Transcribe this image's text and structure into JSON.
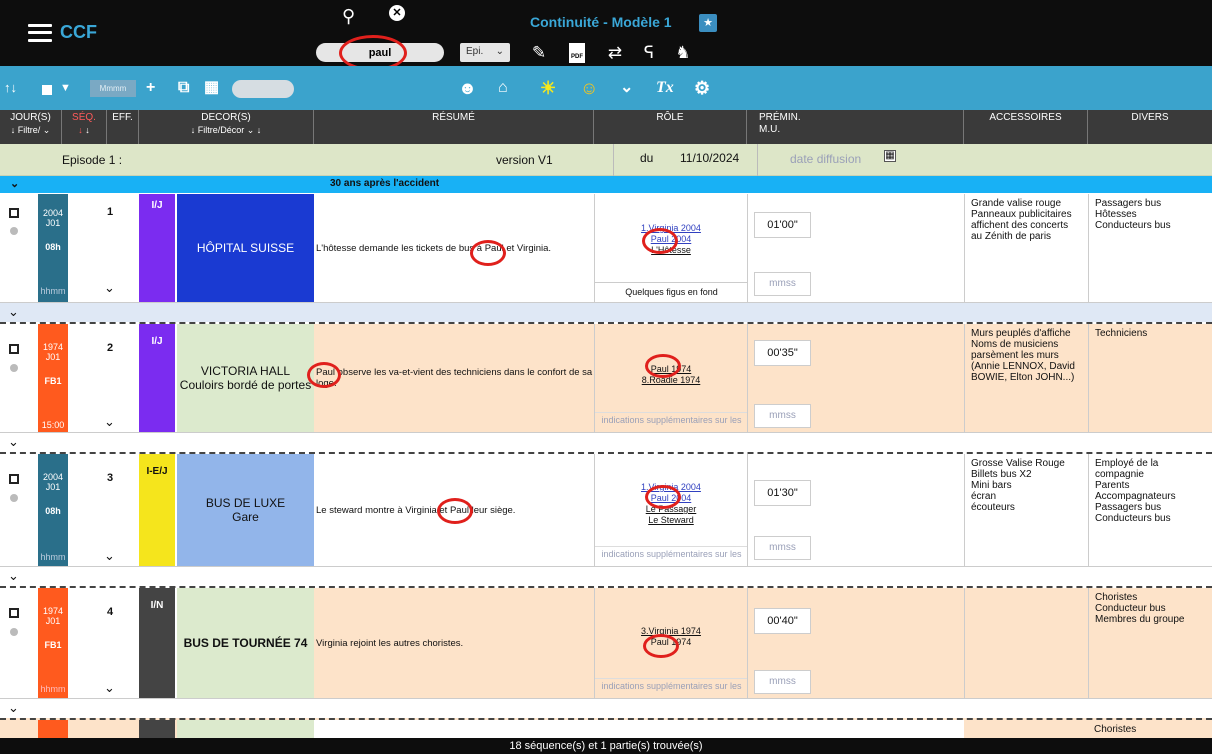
{
  "header": {
    "logo": "CCF",
    "title": "Continuité - Modèle 1",
    "search_value": "paul",
    "episode_select": "Epi.",
    "star": "★"
  },
  "toolbar2": {
    "grey_field": "Mmmm"
  },
  "columns": {
    "jour": "JOUR(S)",
    "jour_filter": "Filtre/",
    "seq": "SÉQ.",
    "eff": "EFF.",
    "decor": "DECOR(S)",
    "decor_filter": "Filtre/Décor",
    "resume": "RÉSUMÉ",
    "role": "RÔLE",
    "premin_1": "PRÉMIN.",
    "premin_2": "M.U.",
    "accessoires": "ACCESSOIRES",
    "divers": "DIVERS"
  },
  "episode": {
    "label": "Episode 1 :",
    "version": "version V1",
    "du": "du",
    "date": "11/10/2024",
    "date_diffusion": "date diffusion"
  },
  "part": {
    "title": "30 ans après l'accident"
  },
  "sequences": [
    {
      "day": "2004 J01",
      "time_code": "08h",
      "hour": "hhmm",
      "num": "1",
      "eff": "I/J",
      "decor_1": "HÔPITAL SUISSE",
      "decor_2": "",
      "resume": "L'hôtesse demande les tickets de bus à Paul et Virginia.",
      "roles": [
        "1.Virginia 2004",
        "Paul 2004",
        "L'Hôtesse"
      ],
      "role_note": "Quelques figus en fond",
      "premin": "01'00\"",
      "premin_ph": "mmss",
      "accessoires": [
        "Grande valise rouge",
        "Panneaux publicitaires",
        "affichent des concerts",
        "au Zénith de paris"
      ],
      "divers": [
        "Passagers bus",
        "Hôtesses",
        "Conducteurs bus"
      ],
      "colors": {
        "day": "#2a6f8a",
        "eff": "#7b2cf0",
        "decor": "#1a3ad2",
        "decor_text": "#ffffff",
        "resume": "#ffffff"
      }
    },
    {
      "day": "1974 J01",
      "time_code": "FB1",
      "hour": "15:00",
      "num": "2",
      "eff": "I/J",
      "decor_1": "VICTORIA HALL",
      "decor_2": "Couloirs bordé de portes",
      "resume": "Paul observe les va-et-vient des techniciens dans le confort de sa loge.",
      "roles": [
        "Paul 1974",
        "8.Roadie 1974"
      ],
      "role_note": "indications supplémentaires sur les",
      "premin": "00'35\"",
      "premin_ph": "mmss",
      "accessoires": [
        "Murs peuplés d'affiche",
        "Noms de musiciens",
        "parsèment les murs",
        "(Annie LENNOX, David",
        "BOWIE, Elton JOHN...)"
      ],
      "divers": [
        "Techniciens"
      ],
      "colors": {
        "day": "#ff5a1e",
        "eff": "#7b2cf0",
        "decor": "#dceacd",
        "decor_text": "#111111",
        "resume": "#fde3c9"
      }
    },
    {
      "day": "2004 J01",
      "time_code": "08h",
      "hour": "hhmm",
      "num": "3",
      "eff": "I-E/J",
      "decor_1": "BUS DE LUXE",
      "decor_2": "Gare",
      "resume": "Le steward montre à Virginia et Paul leur siège.",
      "roles": [
        "1.Virginia 2004",
        "Paul 2004",
        "Le Passager",
        "Le Steward"
      ],
      "role_note": "indications supplémentaires sur les",
      "premin": "01'30\"",
      "premin_ph": "mmss",
      "accessoires": [
        "Grosse Valise Rouge",
        "Billets bus X2",
        "Mini bars",
        "écran",
        "écouteurs"
      ],
      "divers": [
        "Employé de la",
        "compagnie",
        "Parents",
        "Accompagnateurs",
        "Passagers bus",
        "Conducteurs bus"
      ],
      "colors": {
        "day": "#2a6f8a",
        "eff": "#f5e51c",
        "decor": "#92b5ea",
        "decor_text": "#111111",
        "resume": "#ffffff"
      }
    },
    {
      "day": "1974 J01",
      "time_code": "FB1",
      "hour": "hhmm",
      "num": "4",
      "eff": "I/N",
      "decor_1": "BUS DE TOURNÉE 74",
      "decor_2": "",
      "resume": "Virginia rejoint les autres choristes.",
      "roles": [
        "3.Virginia 1974",
        "Paul 1974"
      ],
      "role_note": "indications supplémentaires sur les",
      "premin": "00'40\"",
      "premin_ph": "mmss",
      "accessoires": [],
      "divers": [
        "Choristes",
        "Conducteur bus",
        "Membres du groupe"
      ],
      "colors": {
        "day": "#ff5a1e",
        "eff": "#444444",
        "decor": "#dceacd",
        "decor_text": "#111111",
        "resume": "#fde3c9"
      }
    }
  ],
  "next_divers": "Choristes",
  "status": "18 séquence(s) et 1 partie(s) trouvée(s)"
}
